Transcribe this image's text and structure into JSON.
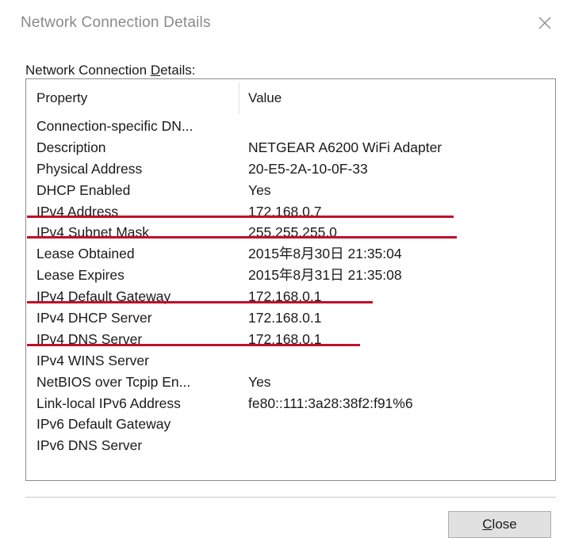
{
  "window": {
    "title": "Network Connection Details",
    "close_icon": "close-icon"
  },
  "group": {
    "label_pre": "Network Connection ",
    "label_access": "D",
    "label_post": "etails:"
  },
  "table": {
    "headers": {
      "property": "Property",
      "value": "Value"
    },
    "rows": [
      {
        "property": "Connection-specific DN...",
        "value": ""
      },
      {
        "property": "Description",
        "value": "NETGEAR A6200 WiFi Adapter"
      },
      {
        "property": "Physical Address",
        "value": "20-E5-2A-10-0F-33"
      },
      {
        "property": "DHCP Enabled",
        "value": "Yes"
      },
      {
        "property": "IPv4 Address",
        "value": "172.168.0.7"
      },
      {
        "property": "IPv4 Subnet Mask",
        "value": "255.255.255.0"
      },
      {
        "property": "Lease Obtained",
        "value": "2015年8月30日 21:35:04"
      },
      {
        "property": "Lease Expires",
        "value": "2015年8月31日 21:35:08"
      },
      {
        "property": "IPv4 Default Gateway",
        "value": "172.168.0.1"
      },
      {
        "property": "IPv4 DHCP Server",
        "value": "172.168.0.1"
      },
      {
        "property": "IPv4 DNS Server",
        "value": "172.168.0.1"
      },
      {
        "property": "IPv4 WINS Server",
        "value": ""
      },
      {
        "property": "NetBIOS over Tcpip En...",
        "value": "Yes"
      },
      {
        "property": "Link-local IPv6 Address",
        "value": "fe80::111:3a28:38f2:f91%6"
      },
      {
        "property": "IPv6 Default Gateway",
        "value": ""
      },
      {
        "property": "IPv6 DNS Server",
        "value": ""
      }
    ],
    "underline_color": "#c0102a"
  },
  "footer": {
    "close_access": "C",
    "close_rest": "lose"
  }
}
